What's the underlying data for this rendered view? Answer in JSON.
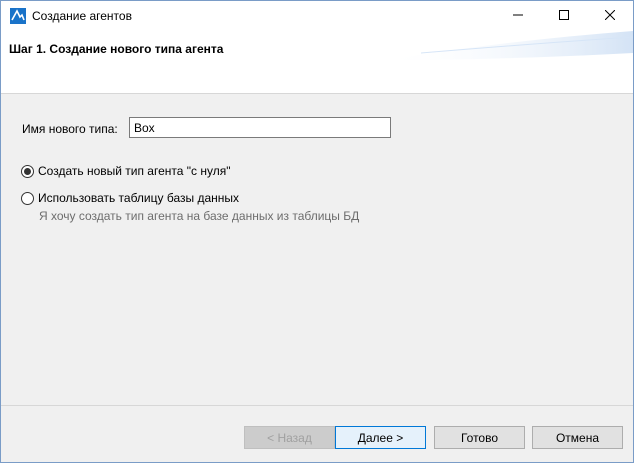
{
  "window": {
    "title": "Создание агентов",
    "icon": "anylogic-logo-icon"
  },
  "titlebar_buttons": {
    "minimize": "minimize-icon",
    "maximize": "maximize-icon",
    "close": "close-icon"
  },
  "header": {
    "step_title": "Шаг 1. Создание нового типа агента"
  },
  "form": {
    "name_label": "Имя нового типа:",
    "name_value": "Box",
    "options": [
      {
        "label": "Создать новый тип агента \"с нуля\"",
        "selected": true
      },
      {
        "label": "Использовать таблицу базы данных",
        "selected": false
      }
    ],
    "db_hint": "Я хочу создать тип агента на базе данных из таблицы БД"
  },
  "footer": {
    "back_label": "< Назад",
    "next_label": "Далее >",
    "finish_label": "Готово",
    "cancel_label": "Отмена"
  },
  "colors": {
    "accent": "#0078d7",
    "border": "#7a9cc7",
    "hint_text": "#6d6d6d"
  }
}
